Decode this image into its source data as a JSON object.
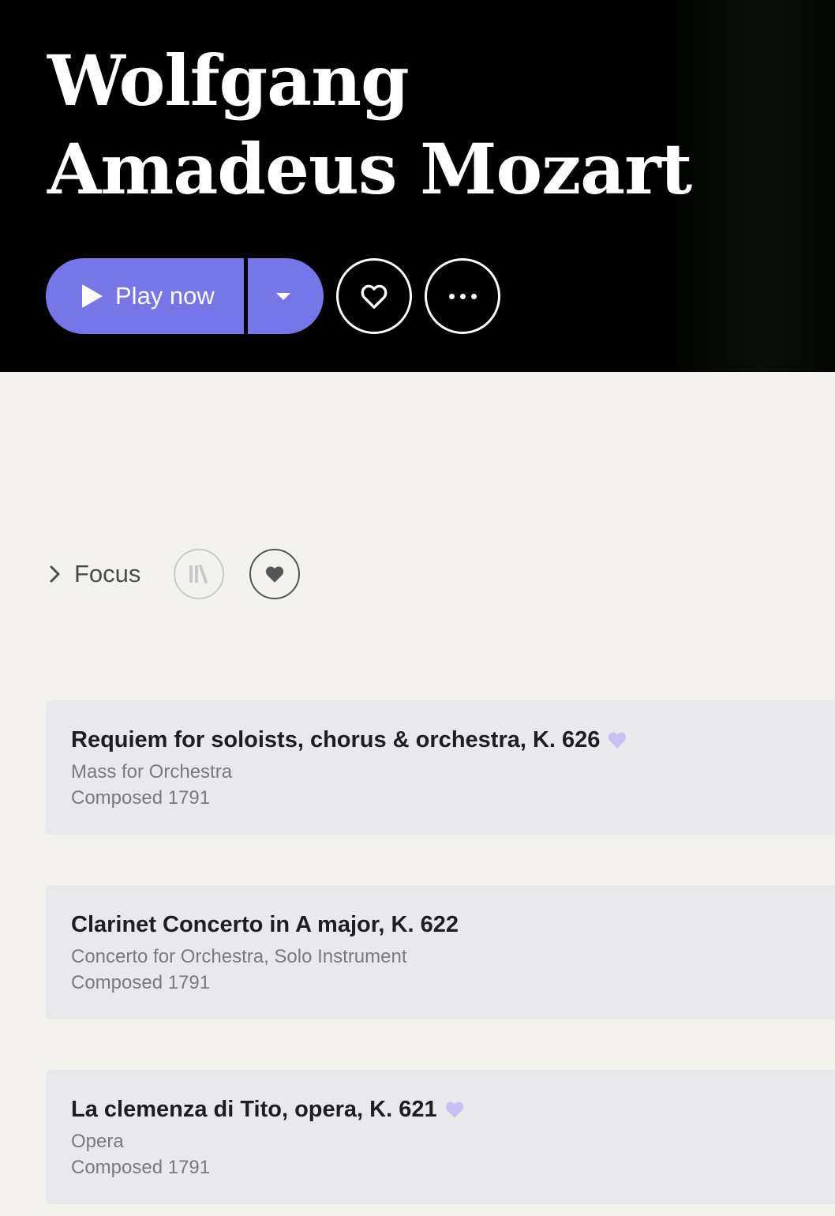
{
  "hero": {
    "name_line1": "Wolfgang",
    "name_line2": "Amadeus Mozart",
    "play_label": "Play now",
    "accent_color": "#7676e9"
  },
  "toolbar": {
    "focus_label": "Focus",
    "icons": [
      "chevron-right-icon",
      "library-icon",
      "heart-filled-icon"
    ]
  },
  "works": [
    {
      "title": "Requiem for soloists, chorus & orchestra, K. 626",
      "type": "Mass for Orchestra",
      "composed": "Composed 1791",
      "favorited": true
    },
    {
      "title": "Clarinet Concerto in A major, K. 622",
      "type": "Concerto for Orchestra, Solo Instrument",
      "composed": "Composed 1791",
      "favorited": false
    },
    {
      "title": "La clemenza di Tito, opera, K. 621",
      "type": "Opera",
      "composed": "Composed 1791",
      "favorited": true
    }
  ],
  "favorite_heart_color": "#c5c1f2"
}
